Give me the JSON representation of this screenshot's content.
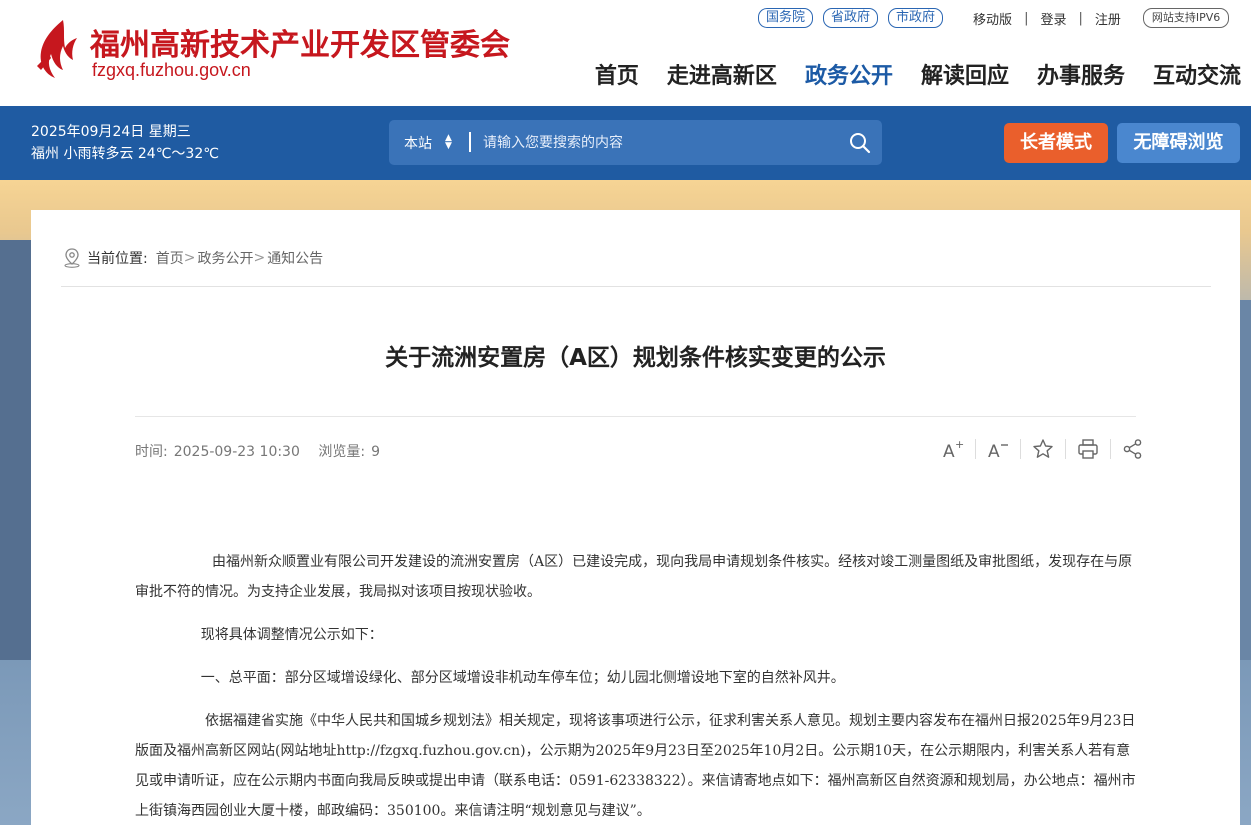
{
  "site": {
    "title": "福州高新技术产业开发区管委会",
    "domain": "fzgxq.fuzhou.gov.cn",
    "brand_color": "#c6171e"
  },
  "top_links": {
    "gov1": "国务院",
    "gov2": "省政府",
    "gov3": "市政府",
    "mobile": "移动版",
    "login": "登录",
    "register": "注册",
    "ipv6": "网站支持IPV6"
  },
  "nav": [
    "首页",
    "走进高新区",
    "政务公开",
    "解读回应",
    "办事服务",
    "互动交流"
  ],
  "nav_active": "政务公开",
  "info": {
    "date": "2025年09月24日 星期三",
    "weather": "福州 小雨转多云 24℃～32℃"
  },
  "search": {
    "scope": "本站",
    "placeholder": "请输入您要搜索的内容"
  },
  "buttons": {
    "elder": "长者模式",
    "accessible": "无障碍浏览"
  },
  "breadcrumb": {
    "label": "当前位置:",
    "items": [
      "首页",
      "政务公开",
      "通知公告"
    ]
  },
  "article": {
    "title": "关于流洲安置房（A区）规划条件核实变更的公示",
    "time_label": "时间:",
    "time": "2025-09-23 10:30",
    "views_label": "浏览量:",
    "views": "9",
    "paragraphs": [
      "由福州新众顺置业有限公司开发建设的流洲安置房（A区）已建设完成，现向我局申请规划条件核实。经核对竣工测量图纸及审批图纸，发现存在与原审批不符的情况。为支持企业发展，我局拟对该项目按现状验收。",
      "现将具体调整情况公示如下：",
      "一、总平面：部分区域增设绿化、部分区域增设非机动车停车位；幼儿园北侧增设地下室的自然补风井。",
      "依据福建省实施《中华人民共和国城乡规划法》相关规定，现将该事项进行公示，征求利害关系人意见。规划主要内容发布在福州日报2025年9月23日版面及福州高新区网站(网站地址http://fzgxq.fuzhou.gov.cn)，公示期为2025年9月23日至2025年10月2日。公示期10天，在公示期限内，利害关系人若有意见或申请听证，应在公示期内书面向我局反映或提出申请（联系电话：0591-62338322）。来信请寄地点如下：福州高新区自然资源和规划局，办公地点：福州市上街镇海西园创业大厦十楼，邮政编码：350100。来信请注明“规划意见与建议”。"
    ]
  },
  "colors": {
    "primary_blue": "#1f5ba2",
    "elder_button": "#ea5f2c",
    "access_button": "#4a87cf"
  }
}
